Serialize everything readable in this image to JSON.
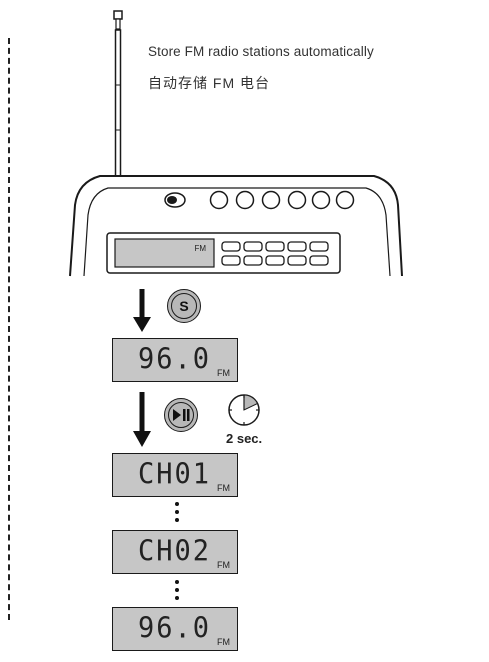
{
  "caption": {
    "english": "Store FM radio stations automatically",
    "chinese": "自动存储 FM 电台"
  },
  "radio": {
    "display_band": "FM"
  },
  "steps": [
    {
      "value": "96.0",
      "unit": "FM"
    },
    {
      "value": "CH01",
      "unit": "FM"
    },
    {
      "value": "CH02",
      "unit": "FM"
    },
    {
      "value": "96.0",
      "unit": "FM"
    }
  ],
  "buttons": {
    "store_label": "S",
    "play_pause_icon": "play-pause-icon"
  },
  "timer": {
    "icon": "timer-icon",
    "duration_label": "2 sec."
  },
  "colors": {
    "lcd_background": "#c6c6c6",
    "button_fill": "#b8b8b8",
    "ink": "#1a1a1a"
  }
}
